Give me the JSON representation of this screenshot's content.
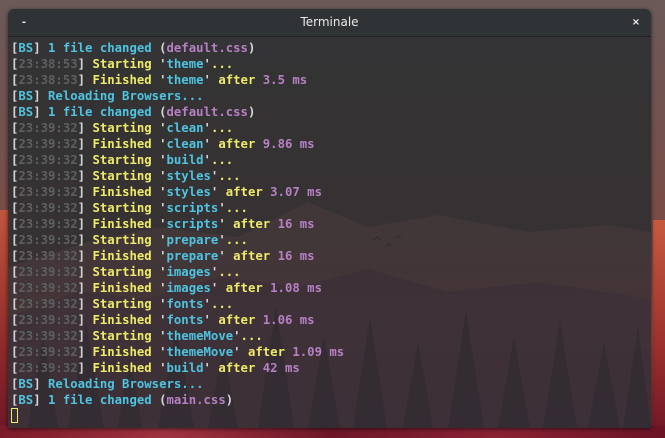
{
  "window": {
    "title": "Terminale",
    "minimize_glyph": "-",
    "close_glyph": "×"
  },
  "colors": {
    "bracket": "#d8d8d8",
    "timestamp": "#5c6063",
    "message": "#f0ea6a",
    "browsersync": "#4ec4e0",
    "highlight": "#b780c4"
  },
  "terminal": {
    "lines": [
      [
        [
          "w",
          "["
        ],
        [
          "c",
          "BS"
        ],
        [
          "w",
          "]"
        ],
        [
          "c",
          " 1 file changed "
        ],
        [
          "w",
          "("
        ],
        [
          "p",
          "default.css"
        ],
        [
          "w",
          ")"
        ]
      ],
      [
        [
          "w",
          "["
        ],
        [
          "d",
          "23:38:53"
        ],
        [
          "w",
          "]"
        ],
        [
          "y",
          " Starting "
        ],
        [
          "w",
          "'"
        ],
        [
          "c",
          "theme"
        ],
        [
          "w",
          "'"
        ],
        [
          "y",
          "..."
        ]
      ],
      [
        [
          "w",
          "["
        ],
        [
          "d",
          "23:38:53"
        ],
        [
          "w",
          "]"
        ],
        [
          "y",
          " Finished "
        ],
        [
          "w",
          "'"
        ],
        [
          "c",
          "theme"
        ],
        [
          "w",
          "'"
        ],
        [
          "y",
          " after "
        ],
        [
          "p",
          "3.5 ms"
        ]
      ],
      [
        [
          "w",
          "["
        ],
        [
          "c",
          "BS"
        ],
        [
          "w",
          "]"
        ],
        [
          "c",
          " Reloading Browsers..."
        ]
      ],
      [
        [
          "w",
          "["
        ],
        [
          "c",
          "BS"
        ],
        [
          "w",
          "]"
        ],
        [
          "c",
          " 1 file changed "
        ],
        [
          "w",
          "("
        ],
        [
          "p",
          "default.css"
        ],
        [
          "w",
          ")"
        ]
      ],
      [
        [
          "w",
          "["
        ],
        [
          "d",
          "23:39:32"
        ],
        [
          "w",
          "]"
        ],
        [
          "y",
          " Starting "
        ],
        [
          "w",
          "'"
        ],
        [
          "c",
          "clean"
        ],
        [
          "w",
          "'"
        ],
        [
          "y",
          "..."
        ]
      ],
      [
        [
          "w",
          "["
        ],
        [
          "d",
          "23:39:32"
        ],
        [
          "w",
          "]"
        ],
        [
          "y",
          " Finished "
        ],
        [
          "w",
          "'"
        ],
        [
          "c",
          "clean"
        ],
        [
          "w",
          "'"
        ],
        [
          "y",
          " after "
        ],
        [
          "p",
          "9.86 ms"
        ]
      ],
      [
        [
          "w",
          "["
        ],
        [
          "d",
          "23:39:32"
        ],
        [
          "w",
          "]"
        ],
        [
          "y",
          " Starting "
        ],
        [
          "w",
          "'"
        ],
        [
          "c",
          "build"
        ],
        [
          "w",
          "'"
        ],
        [
          "y",
          "..."
        ]
      ],
      [
        [
          "w",
          "["
        ],
        [
          "d",
          "23:39:32"
        ],
        [
          "w",
          "]"
        ],
        [
          "y",
          " Starting "
        ],
        [
          "w",
          "'"
        ],
        [
          "c",
          "styles"
        ],
        [
          "w",
          "'"
        ],
        [
          "y",
          "..."
        ]
      ],
      [
        [
          "w",
          "["
        ],
        [
          "d",
          "23:39:32"
        ],
        [
          "w",
          "]"
        ],
        [
          "y",
          " Finished "
        ],
        [
          "w",
          "'"
        ],
        [
          "c",
          "styles"
        ],
        [
          "w",
          "'"
        ],
        [
          "y",
          " after "
        ],
        [
          "p",
          "3.07 ms"
        ]
      ],
      [
        [
          "w",
          "["
        ],
        [
          "d",
          "23:39:32"
        ],
        [
          "w",
          "]"
        ],
        [
          "y",
          " Starting "
        ],
        [
          "w",
          "'"
        ],
        [
          "c",
          "scripts"
        ],
        [
          "w",
          "'"
        ],
        [
          "y",
          "..."
        ]
      ],
      [
        [
          "w",
          "["
        ],
        [
          "d",
          "23:39:32"
        ],
        [
          "w",
          "]"
        ],
        [
          "y",
          " Finished "
        ],
        [
          "w",
          "'"
        ],
        [
          "c",
          "scripts"
        ],
        [
          "w",
          "'"
        ],
        [
          "y",
          " after "
        ],
        [
          "p",
          "16 ms"
        ]
      ],
      [
        [
          "w",
          "["
        ],
        [
          "d",
          "23:39:32"
        ],
        [
          "w",
          "]"
        ],
        [
          "y",
          " Starting "
        ],
        [
          "w",
          "'"
        ],
        [
          "c",
          "prepare"
        ],
        [
          "w",
          "'"
        ],
        [
          "y",
          "..."
        ]
      ],
      [
        [
          "w",
          "["
        ],
        [
          "d",
          "23:39:32"
        ],
        [
          "w",
          "]"
        ],
        [
          "y",
          " Finished "
        ],
        [
          "w",
          "'"
        ],
        [
          "c",
          "prepare"
        ],
        [
          "w",
          "'"
        ],
        [
          "y",
          " after "
        ],
        [
          "p",
          "16 ms"
        ]
      ],
      [
        [
          "w",
          "["
        ],
        [
          "d",
          "23:39:32"
        ],
        [
          "w",
          "]"
        ],
        [
          "y",
          " Starting "
        ],
        [
          "w",
          "'"
        ],
        [
          "c",
          "images"
        ],
        [
          "w",
          "'"
        ],
        [
          "y",
          "..."
        ]
      ],
      [
        [
          "w",
          "["
        ],
        [
          "d",
          "23:39:32"
        ],
        [
          "w",
          "]"
        ],
        [
          "y",
          " Finished "
        ],
        [
          "w",
          "'"
        ],
        [
          "c",
          "images"
        ],
        [
          "w",
          "'"
        ],
        [
          "y",
          " after "
        ],
        [
          "p",
          "1.08 ms"
        ]
      ],
      [
        [
          "w",
          "["
        ],
        [
          "d",
          "23:39:32"
        ],
        [
          "w",
          "]"
        ],
        [
          "y",
          " Starting "
        ],
        [
          "w",
          "'"
        ],
        [
          "c",
          "fonts"
        ],
        [
          "w",
          "'"
        ],
        [
          "y",
          "..."
        ]
      ],
      [
        [
          "w",
          "["
        ],
        [
          "d",
          "23:39:32"
        ],
        [
          "w",
          "]"
        ],
        [
          "y",
          " Finished "
        ],
        [
          "w",
          "'"
        ],
        [
          "c",
          "fonts"
        ],
        [
          "w",
          "'"
        ],
        [
          "y",
          " after "
        ],
        [
          "p",
          "1.06 ms"
        ]
      ],
      [
        [
          "w",
          "["
        ],
        [
          "d",
          "23:39:32"
        ],
        [
          "w",
          "]"
        ],
        [
          "y",
          " Starting "
        ],
        [
          "w",
          "'"
        ],
        [
          "c",
          "themeMove"
        ],
        [
          "w",
          "'"
        ],
        [
          "y",
          "..."
        ]
      ],
      [
        [
          "w",
          "["
        ],
        [
          "d",
          "23:39:32"
        ],
        [
          "w",
          "]"
        ],
        [
          "y",
          " Finished "
        ],
        [
          "w",
          "'"
        ],
        [
          "c",
          "themeMove"
        ],
        [
          "w",
          "'"
        ],
        [
          "y",
          " after "
        ],
        [
          "p",
          "1.09 ms"
        ]
      ],
      [
        [
          "w",
          "["
        ],
        [
          "d",
          "23:39:32"
        ],
        [
          "w",
          "]"
        ],
        [
          "y",
          " Finished "
        ],
        [
          "w",
          "'"
        ],
        [
          "c",
          "build"
        ],
        [
          "w",
          "'"
        ],
        [
          "y",
          " after "
        ],
        [
          "p",
          "42 ms"
        ]
      ],
      [
        [
          "w",
          "["
        ],
        [
          "c",
          "BS"
        ],
        [
          "w",
          "]"
        ],
        [
          "c",
          " Reloading Browsers..."
        ]
      ],
      [
        [
          "w",
          "["
        ],
        [
          "c",
          "BS"
        ],
        [
          "w",
          "]"
        ],
        [
          "c",
          " 1 file changed "
        ],
        [
          "w",
          "("
        ],
        [
          "p",
          "main.css"
        ],
        [
          "w",
          ")"
        ]
      ]
    ]
  }
}
